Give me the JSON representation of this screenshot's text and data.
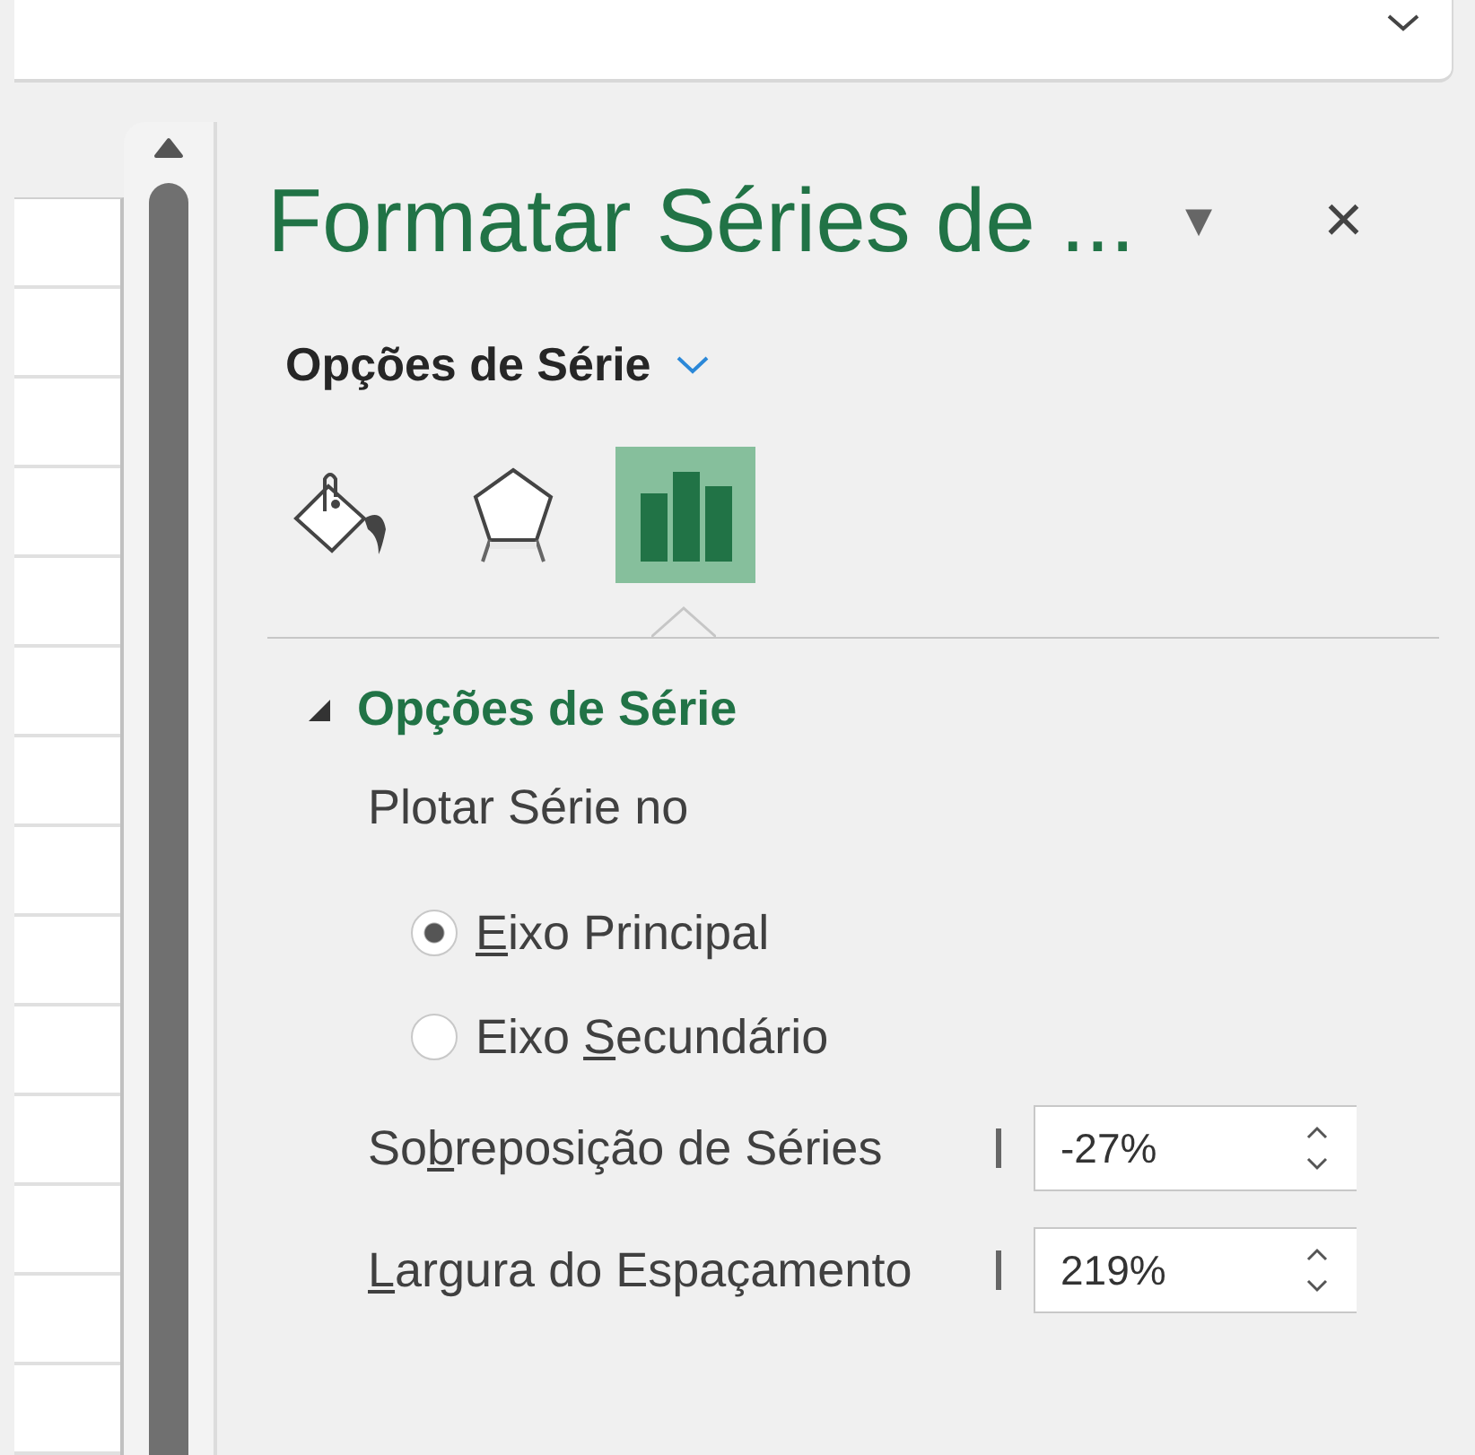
{
  "pane": {
    "title": "Formatar Séries de ...",
    "menu_caret": "▾",
    "close": "×"
  },
  "options_selector": {
    "label": "Opções de Série"
  },
  "tabs": [
    {
      "kind": "fill",
      "selected": false
    },
    {
      "kind": "effects",
      "selected": false
    },
    {
      "kind": "series",
      "selected": true
    }
  ],
  "section": {
    "title": "Opções de Série",
    "expanded": true,
    "plot_label": "Plotar Série no",
    "radios": [
      {
        "key": "E",
        "rest": "ixo Principal",
        "selected": true
      },
      {
        "before": "Eixo ",
        "key": "S",
        "rest": "ecundário",
        "selected": false
      }
    ],
    "spinners": [
      {
        "before": "So",
        "key": "b",
        "rest": "reposição de Séries",
        "value": "-27%"
      },
      {
        "key": "L",
        "rest": "argura do Espaçamento",
        "value": "219%"
      }
    ]
  }
}
